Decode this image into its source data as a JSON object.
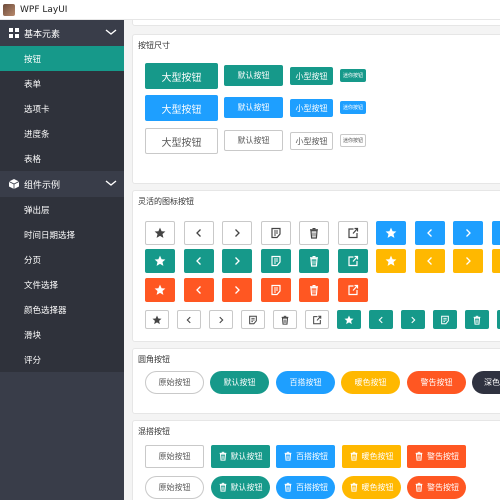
{
  "window": {
    "title": "WPF LayUI"
  },
  "sidebar": {
    "groups": [
      {
        "label": "基本元素",
        "items": [
          "按钮",
          "表单",
          "选项卡",
          "进度条",
          "表格"
        ]
      },
      {
        "label": "组件示例",
        "items": [
          "弹出层",
          "时间日期选择",
          "分页",
          "文件选择",
          "颜色选择器",
          "滑块",
          "评分"
        ]
      }
    ],
    "active_item": "按钮"
  },
  "sections": {
    "sizes": {
      "title": "按钮尺寸",
      "large": "大型按钮",
      "default": "默认按钮",
      "small": "小型按钮",
      "mini": "迷你按钮"
    },
    "icons": {
      "title": "灵活的图标按钮"
    },
    "rounded": {
      "title": "圆角按钮",
      "labels": [
        "原始按钮",
        "默认按钮",
        "百搭按钮",
        "暖色按钮",
        "警告按钮",
        "深色"
      ]
    },
    "mixed": {
      "title": "混搭按钮",
      "labels": [
        "原始按钮",
        "默认按钮",
        "百搭按钮",
        "暖色按钮",
        "警告按钮"
      ]
    }
  },
  "colors": {
    "teal": "#16998a",
    "blue": "#1e9fff",
    "orange": "#ff5722",
    "yellow": "#ffb800",
    "dark": "#2f3240",
    "sidebar": "#393d49"
  }
}
